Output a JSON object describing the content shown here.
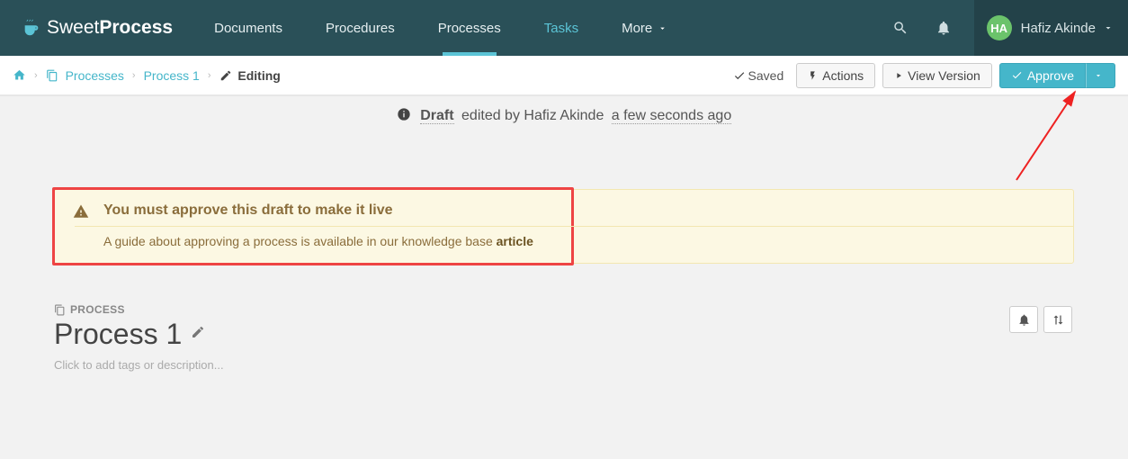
{
  "brand": {
    "sweet": "Sweet",
    "process": "Process"
  },
  "nav": {
    "documents": "Documents",
    "procedures": "Procedures",
    "processes": "Processes",
    "tasks": "Tasks",
    "more": "More"
  },
  "user": {
    "initials": "HA",
    "name": "Hafiz Akinde"
  },
  "breadcrumb": {
    "processes": "Processes",
    "item": "Process 1",
    "editing": "Editing"
  },
  "toolbar": {
    "saved": "Saved",
    "actions": "Actions",
    "view_version": "View Version",
    "approve": "Approve"
  },
  "draft_banner": {
    "draft": "Draft",
    "edited_by": "edited by Hafiz Akinde",
    "time": "a few seconds ago"
  },
  "alert": {
    "title": "You must approve this draft to make it live",
    "body_pre": "A guide about approving a process is available in our knowledge base ",
    "body_link": "article"
  },
  "process": {
    "label": "PROCESS",
    "title": "Process 1",
    "tags_hint": "Click to add tags or description..."
  }
}
